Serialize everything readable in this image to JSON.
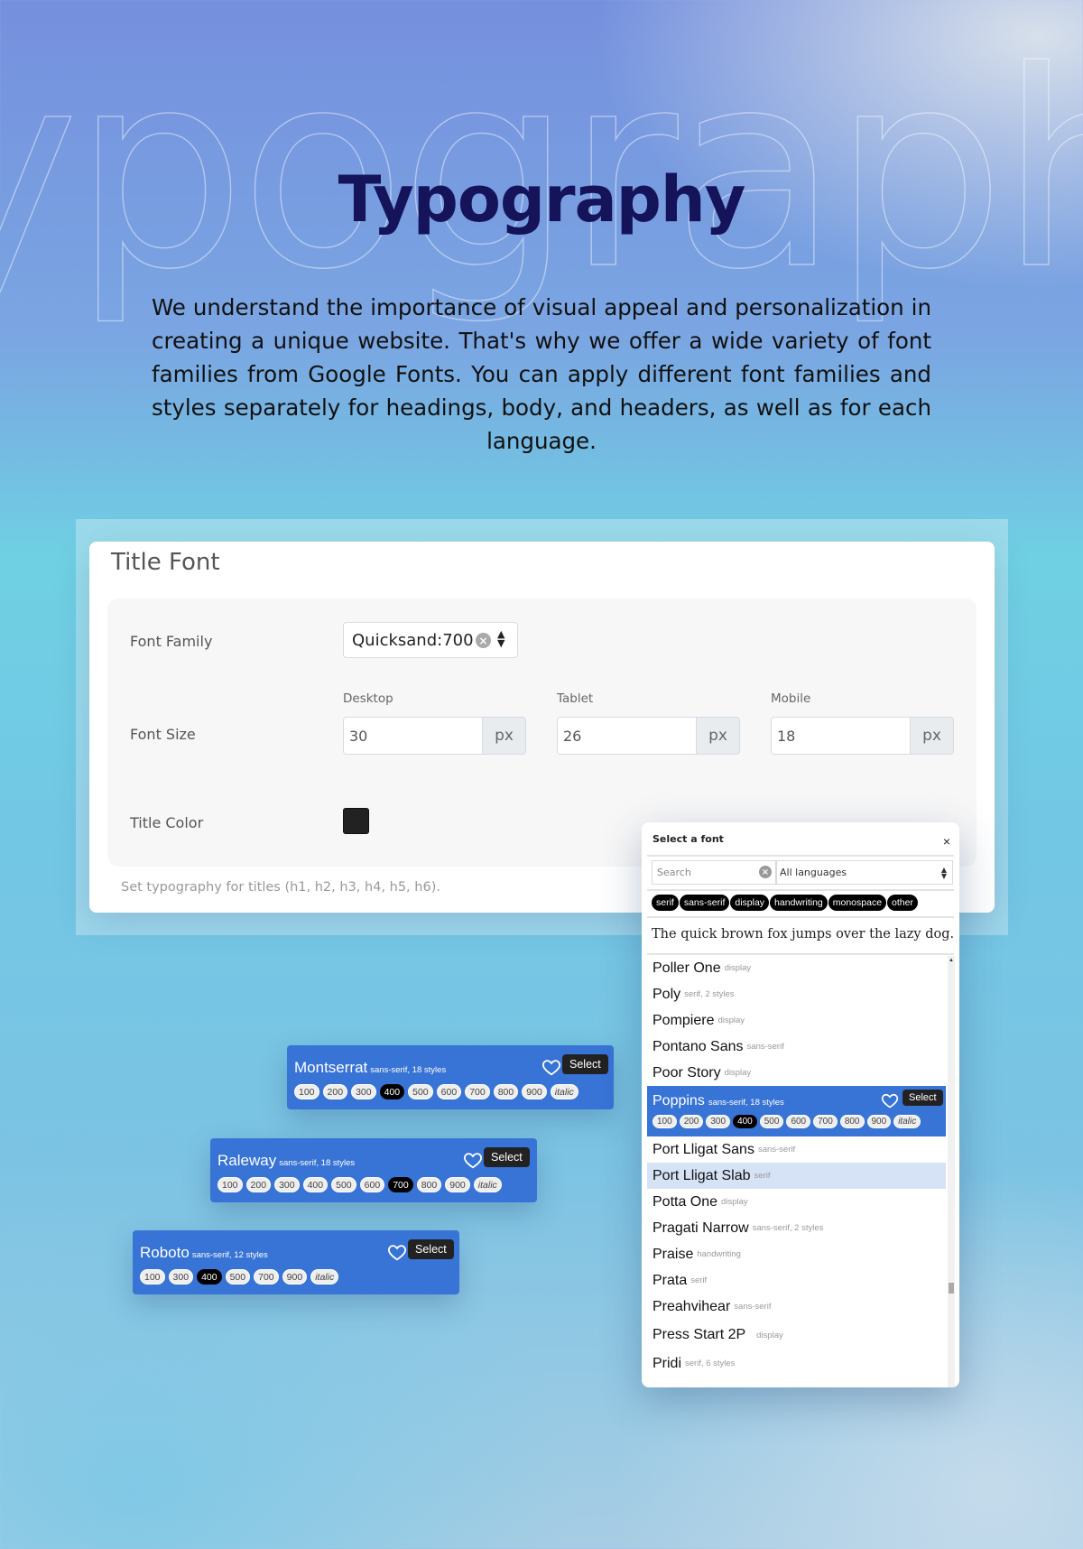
{
  "hero": {
    "background_word": "ypography",
    "title": "Typography",
    "description": "We understand the importance of visual appeal and personalization in creating a unique website. That's why we offer a wide variety of font families from Google Fonts. You can apply different font families and styles separately for headings, body, and headers, as well as for each language."
  },
  "settings": {
    "card_title": "Title Font",
    "font_family_label": "Font Family",
    "font_family_value": "Quicksand:700",
    "font_size_label": "Font Size",
    "sizes": [
      {
        "device": "Desktop",
        "value": "30",
        "unit": "px"
      },
      {
        "device": "Tablet",
        "value": "26",
        "unit": "px"
      },
      {
        "device": "Mobile",
        "value": "18",
        "unit": "px"
      }
    ],
    "title_color_label": "Title Color",
    "title_color_value": "#222222",
    "help_text": "Set typography for titles (h1, h2, h3, h4, h5, h6)."
  },
  "font_cards": [
    {
      "name": "Montserrat",
      "meta": "sans-serif, 18 styles",
      "select_label": "Select",
      "weights": [
        "100",
        "200",
        "300",
        "400",
        "500",
        "600",
        "700",
        "800",
        "900",
        "italic"
      ],
      "active": "400"
    },
    {
      "name": "Raleway",
      "meta": "sans-serif, 18 styles",
      "select_label": "Select",
      "weights": [
        "100",
        "200",
        "300",
        "400",
        "500",
        "600",
        "700",
        "800",
        "900",
        "italic"
      ],
      "active": "700"
    },
    {
      "name": "Roboto",
      "meta": "sans-serif, 12 styles",
      "select_label": "Select",
      "weights": [
        "100",
        "300",
        "400",
        "500",
        "700",
        "900",
        "italic"
      ],
      "active": "400"
    }
  ],
  "picker": {
    "title": "Select a font",
    "close_icon": "×",
    "search_placeholder": "Search",
    "language": "All languages",
    "categories": [
      "serif",
      "sans-serif",
      "display",
      "handwriting",
      "monospace",
      "other"
    ],
    "sample_text": "The quick brown fox jumps over the lazy dog.",
    "fonts": [
      {
        "name": "Poller One",
        "meta": "display"
      },
      {
        "name": "Poly",
        "meta": "serif, 2 styles"
      },
      {
        "name": "Pompiere",
        "meta": "display"
      },
      {
        "name": "Pontano Sans",
        "meta": "sans-serif"
      },
      {
        "name": "Poor Story",
        "meta": "display"
      },
      {
        "name": "Poppins",
        "meta": "sans-serif, 18 styles",
        "selected": true,
        "select_label": "Select",
        "weights": [
          "100",
          "200",
          "300",
          "400",
          "500",
          "600",
          "700",
          "800",
          "900",
          "italic"
        ],
        "active": "400"
      },
      {
        "name": "Port Lligat Sans",
        "meta": "sans-serif"
      },
      {
        "name": "Port Lligat Slab",
        "meta": "serif",
        "hover": true
      },
      {
        "name": "Potta One",
        "meta": "display"
      },
      {
        "name": "Pragati Narrow",
        "meta": "sans-serif, 2 styles"
      },
      {
        "name": "Praise",
        "meta": "handwriting"
      },
      {
        "name": "Prata",
        "meta": "serif"
      },
      {
        "name": "Preahvihear",
        "meta": "sans-serif"
      },
      {
        "name": "Press Start 2P",
        "meta": "display"
      },
      {
        "name": "Pridi",
        "meta": "serif, 6 styles"
      }
    ]
  },
  "colors": {
    "accent": "#3873d6",
    "title": "#15135a",
    "hover": "#d6e2f5"
  }
}
